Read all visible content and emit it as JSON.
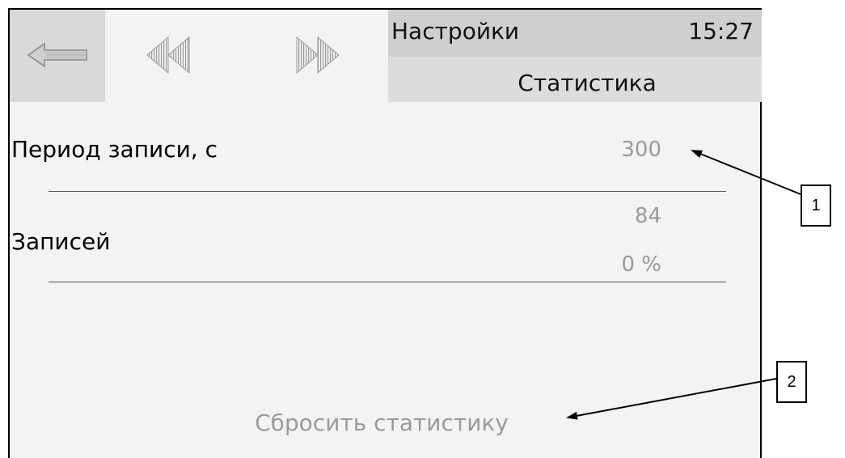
{
  "header": {
    "title": "Настройки",
    "time": "15:27",
    "subtitle": "Статистика"
  },
  "nav": {
    "back_icon": "arrow-left-icon",
    "prev_icon": "double-left-icon",
    "next_icon": "double-right-icon"
  },
  "settings": {
    "record_period_label": "Период записи, с",
    "record_period_value": "300",
    "records_label": "Записей",
    "records_count": "84",
    "records_percent": "0 %"
  },
  "actions": {
    "reset_label": "Сбросить статистику"
  },
  "callouts": {
    "one": "1",
    "two": "2"
  }
}
